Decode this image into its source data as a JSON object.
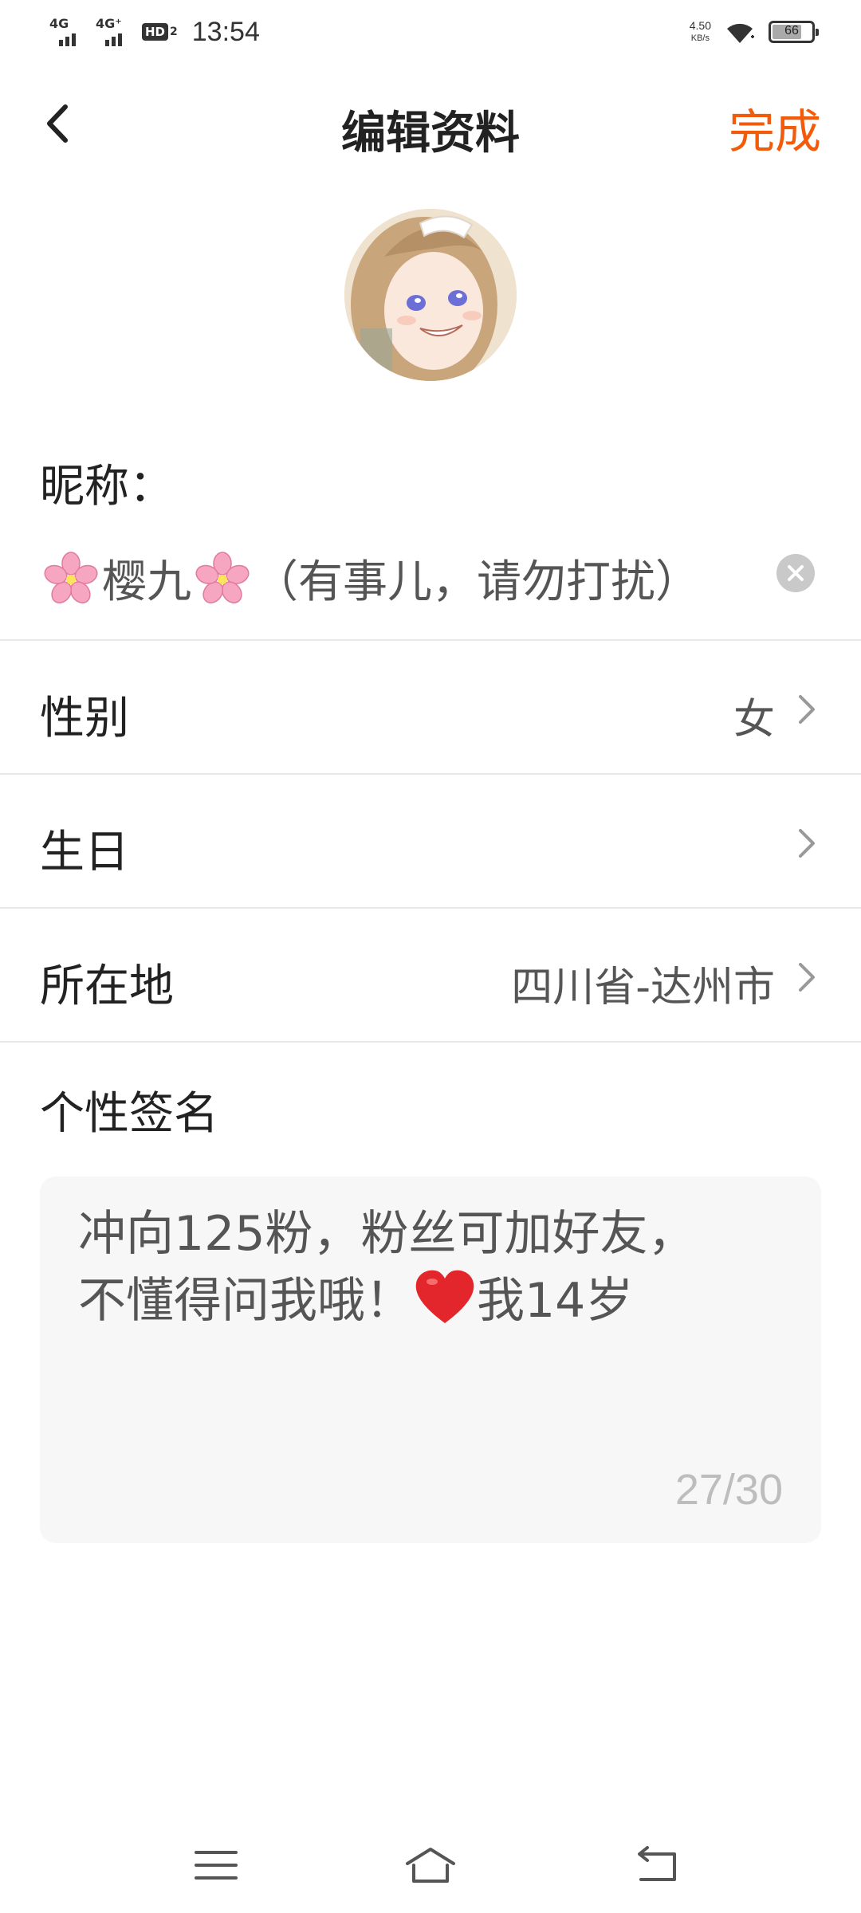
{
  "status_bar": {
    "net1": "4G",
    "net2": "4G⁺",
    "hd": "HD",
    "hd_sub": "2",
    "time": "13:54",
    "speed_value": "4.50",
    "speed_unit": "KB/s",
    "battery": "66",
    "icons": [
      "signal-icon",
      "wifi-icon",
      "battery-icon"
    ]
  },
  "nav": {
    "title": "编辑资料",
    "done_label": "完成",
    "done_color": "#f25b0a"
  },
  "nickname": {
    "label": "昵称：",
    "prefix_emoji": "cherry-blossom-icon",
    "name": "樱九",
    "suffix_emoji": "cherry-blossom-icon",
    "note": "（有事儿，请勿打扰）"
  },
  "rows": [
    {
      "label": "性别",
      "value": "女"
    },
    {
      "label": "生日",
      "value": ""
    },
    {
      "label": "所在地",
      "value": "四川省-达州市"
    }
  ],
  "signature": {
    "label": "个性签名",
    "text_line1": "冲向125粉，粉丝可加好友，",
    "text_line2_a": "不懂得问我哦！",
    "text_line2_b": "我14岁",
    "counter": "27/30"
  },
  "system_nav": {
    "icons": [
      "menu-icon",
      "home-icon",
      "back-icon"
    ]
  }
}
